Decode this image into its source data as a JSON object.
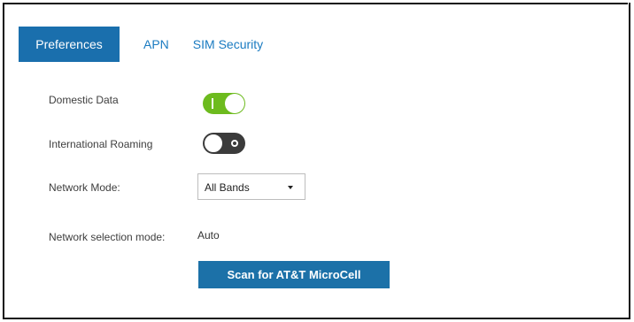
{
  "tabs": [
    {
      "label": "Preferences",
      "active": true
    },
    {
      "label": "APN",
      "active": false
    },
    {
      "label": "SIM Security",
      "active": false
    }
  ],
  "settings": {
    "domestic_data": {
      "label": "Domestic Data",
      "enabled": true
    },
    "international_roaming": {
      "label": "International Roaming",
      "enabled": false
    },
    "network_mode": {
      "label": "Network Mode:",
      "selected": "All Bands"
    },
    "network_selection_mode": {
      "label": "Network selection mode:",
      "value": "Auto"
    }
  },
  "scan_button": {
    "label": "Scan for AT&T MicroCell"
  },
  "colors": {
    "active_tab": "#1a6fad",
    "tab_link": "#1a7bc1",
    "toggle_on": "#6dbb1e",
    "toggle_off": "#3b3b3b",
    "button": "#1c71a8"
  },
  "icons": {
    "toggle_on_mark": "I",
    "toggle_off_mark": "O",
    "dropdown": "caret-down"
  }
}
